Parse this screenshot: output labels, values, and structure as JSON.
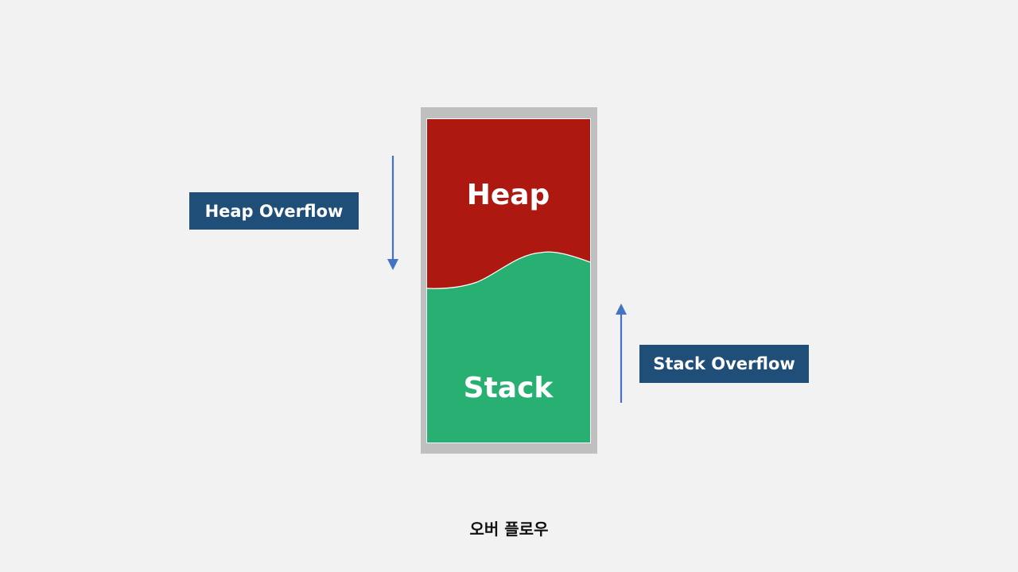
{
  "memory": {
    "heap_label": "Heap",
    "stack_label": "Stack"
  },
  "labels": {
    "heap_overflow": "Heap Overflow",
    "stack_overflow": "Stack Overflow"
  },
  "caption": "오버 플로우",
  "colors": {
    "background": "#f2f2f2",
    "frame": "#bfbfbf",
    "heap": "#ad1910",
    "stack": "#27b072",
    "label_box": "#1f4e79",
    "arrow": "#4472c4"
  }
}
